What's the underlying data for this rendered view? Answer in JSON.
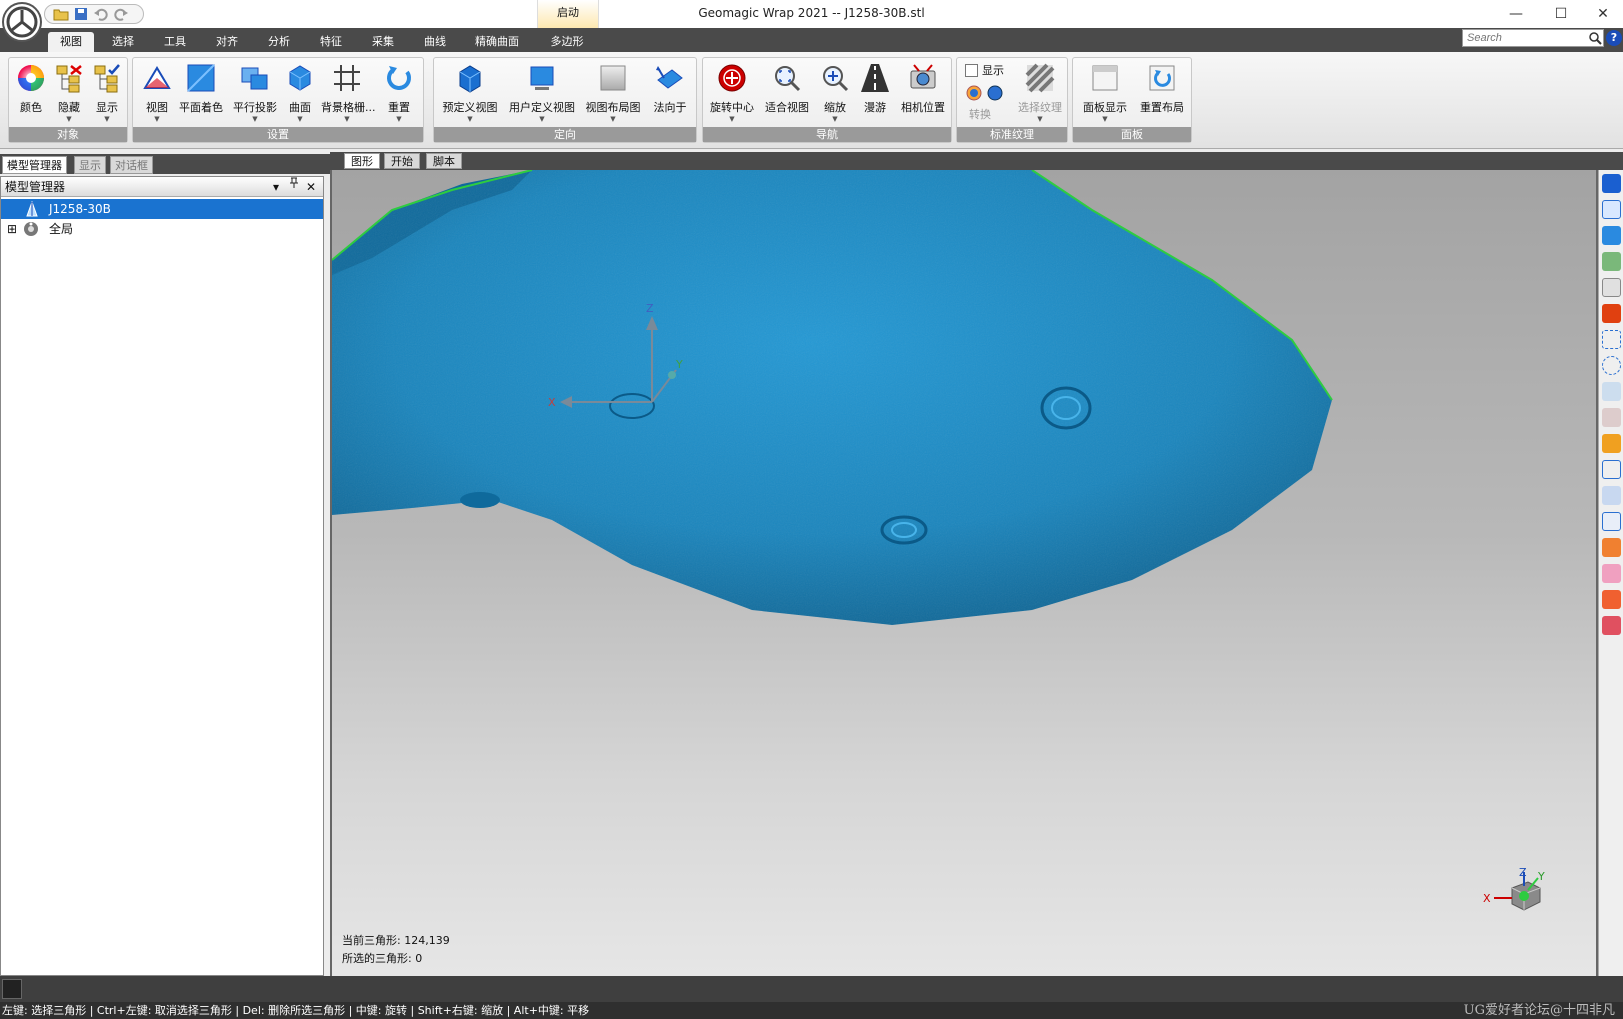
{
  "window": {
    "title": "Geomagic Wrap 2021 -- J1258-30B.stl",
    "context_tab": "启动",
    "minimize": "—",
    "maximize": "☐",
    "close": "✕"
  },
  "ribbon_tabs": [
    "视图",
    "选择",
    "工具",
    "对齐",
    "分析",
    "特征",
    "采集",
    "曲线",
    "精确曲面",
    "多边形"
  ],
  "active_tab": "视图",
  "search": {
    "placeholder": "Search"
  },
  "help_label": "?",
  "groups": [
    {
      "label": "对象",
      "tools": [
        "颜色",
        "隐藏",
        "显示"
      ]
    },
    {
      "label": "设置",
      "tools": [
        "视图",
        "平面着色",
        "平行投影",
        "曲面",
        "背景格栅...",
        "重置"
      ]
    },
    {
      "label": "定向",
      "tools": [
        "预定义视图",
        "用户定义视图",
        "视图布局图",
        "法向于"
      ]
    },
    {
      "label": "导航",
      "tools": [
        "旋转中心",
        "适合视图",
        "缩放",
        "漫游",
        "相机位置"
      ]
    },
    {
      "label": "标准纹理",
      "checkbox": "显示",
      "convert": "转换",
      "tools": [
        "选择纹理"
      ]
    },
    {
      "label": "面板",
      "tools": [
        "面板显示",
        "重置布局"
      ]
    }
  ],
  "panel_tabs": [
    "模型管理器",
    "显示",
    "对话框"
  ],
  "panel_title": "模型管理器",
  "panel_controls": {
    "dropdown": "▾",
    "pin": "📌",
    "close": "✕"
  },
  "tree": [
    {
      "label": "J1258-30B",
      "selected": true
    },
    {
      "label": "全局",
      "expander": "⊞"
    }
  ],
  "viewport_tabs": [
    "图形",
    "开始",
    "脚本"
  ],
  "triad": {
    "x": "X",
    "y": "Y",
    "z": "Z"
  },
  "info": {
    "current_triangles": "当前三角形: 124,139",
    "selected_triangles": "所选的三角形: 0"
  },
  "status_hint": "左键: 选择三角形 | Ctrl+左键: 取消选择三角形 | Del: 删除所选三角形 | 中键: 旋转 | Shift+右键: 缩放 | Alt+中键: 平移",
  "watermark": "UG爱好者论坛@十四非凡",
  "colors": {
    "mesh": "#1c8fcb",
    "mesh_edge": "#22cc44",
    "selection": "#1a73d0"
  }
}
